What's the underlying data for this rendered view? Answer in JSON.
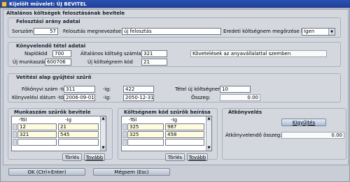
{
  "window": {
    "title": "Kijelölt művelet: ÚJ BEVITEL"
  },
  "header": {
    "title": "Általános költségek felosztásának bevitele"
  },
  "felosztas": {
    "section_title": "Felosztási arány adatai",
    "sorszam_label": "Sorszám",
    "sorszam_value": "57",
    "megnevezes_label": "Felosztás megnevezése",
    "megnevezes_value": "új felosztás",
    "eredeti_label": "Eredeti költségnem megőrzése kell",
    "eredeti_value": "Igen"
  },
  "konyvelendo": {
    "section_title": "Könyvelendő tétel adatai",
    "naplokod_label": "Naplókód",
    "naplokod_value": "700",
    "alt_koltseg_label": "Általános költség számla:",
    "alt_koltseg_value": "321",
    "alt_koltseg_desc": "Követelések az anyavállalattal szemben",
    "munkaszam_label": "Új munkaszám:",
    "munkaszam_value": "600706",
    "uj_koltsegnem_label": "Új költségnem kód",
    "uj_koltsegnem_value": "21"
  },
  "vetitesi": {
    "section_title": "Vetítési alap gyűjtési szűrő",
    "fokonyvi_label": "Főkönyvi szám -tól:",
    "fokonyvi_from": "311",
    "fokonyvi_ig_label": "-ig:",
    "fokonyvi_to": "422",
    "tetel_label": "Tétel új költségnem:",
    "tetel_value": "10",
    "datum_label": "Könyvelési dátum -tól:",
    "datum_from": "2006-09-01",
    "datum_ig_label": "-ig:",
    "datum_to": "2050-12-31",
    "osszeg_label": "Összeg:",
    "osszeg_value": "0.00"
  },
  "munkaszam_szuro": {
    "section_title": "Munkaszám szűrők bevitele",
    "col_tol": "-Tól",
    "col_ig": "-Ig",
    "rows": [
      {
        "tol": "12",
        "ig": "21"
      },
      {
        "tol": "321",
        "ig": "545"
      }
    ],
    "torles": "Törlés",
    "tovabb": "Tovább"
  },
  "koltsegnem_szuro": {
    "section_title": "Költségnem kód szűrők beírása",
    "col_tol": "-Tól",
    "col_ig": "-Ig",
    "rows": [
      {
        "tol": "325",
        "ig": "987"
      },
      {
        "tol": "325",
        "ig": "458"
      }
    ],
    "torles": "Törlés",
    "tovabb": "Tovább"
  },
  "atkonyveles": {
    "section_title": "Átkönyvelés",
    "kigyujtes": "Kigyűjtés",
    "osszeg_label": "Átkönyvelendő összeg:",
    "osszeg_value": "0.00"
  },
  "footer": {
    "ok": "OK (Ctrl+Enter)",
    "megsem": "Mégsem (Esc)"
  }
}
